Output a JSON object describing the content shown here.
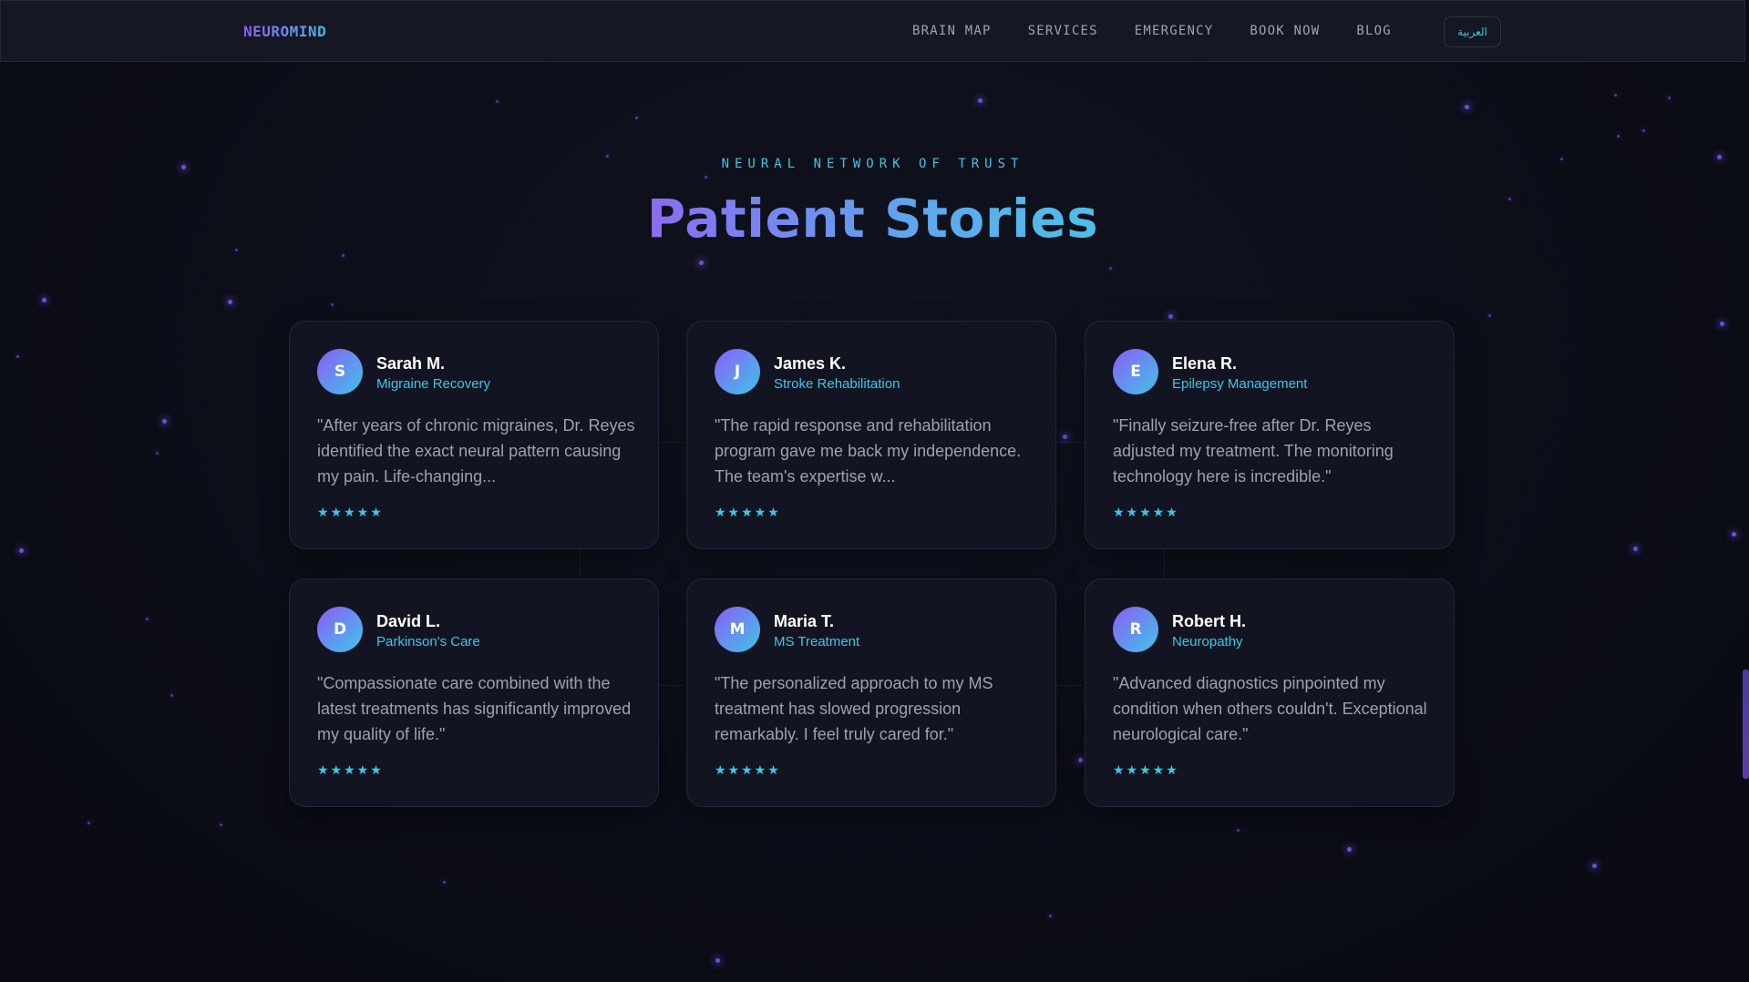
{
  "brand": "NEUROMIND",
  "nav": {
    "links": [
      "BRAIN MAP",
      "SERVICES",
      "EMERGENCY",
      "BOOK NOW",
      "BLOG"
    ],
    "language_button": "العربية"
  },
  "section": {
    "eyebrow": "NEURAL NETWORK OF TRUST",
    "title": "Patient Stories"
  },
  "testimonials": [
    {
      "initial": "S",
      "name": "Sarah M.",
      "condition": "Migraine Recovery",
      "quote": "\"After years of chronic migraines, Dr. Reyes identified the exact neural pattern causing my pain. Life-changing...",
      "stars": "★★★★★"
    },
    {
      "initial": "J",
      "name": "James K.",
      "condition": "Stroke Rehabilitation",
      "quote": "\"The rapid response and rehabilitation program gave me back my independence. The team's expertise w...",
      "stars": "★★★★★"
    },
    {
      "initial": "E",
      "name": "Elena R.",
      "condition": "Epilepsy Management",
      "quote": "\"Finally seizure-free after Dr. Reyes adjusted my treatment. The monitoring technology here is incredible.\"",
      "stars": "★★★★★"
    },
    {
      "initial": "D",
      "name": "David L.",
      "condition": "Parkinson's Care",
      "quote": "\"Compassionate care combined with the latest treatments has significantly improved my quality of life.\"",
      "stars": "★★★★★"
    },
    {
      "initial": "M",
      "name": "Maria T.",
      "condition": "MS Treatment",
      "quote": "\"The personalized approach to my MS treatment has slowed progression remarkably. I feel truly cared for.\"",
      "stars": "★★★★★"
    },
    {
      "initial": "R",
      "name": "Robert H.",
      "condition": "Neuropathy",
      "quote": "\"Advanced diagnostics pinpointed my condition when others couldn't. Exceptional neurological care.\"",
      "stars": "★★★★★"
    }
  ],
  "colors": {
    "background": "#0b0d17",
    "accent_cyan": "#3fc5e8",
    "accent_purple": "#8b5cf6",
    "card_bg": "#121521"
  }
}
